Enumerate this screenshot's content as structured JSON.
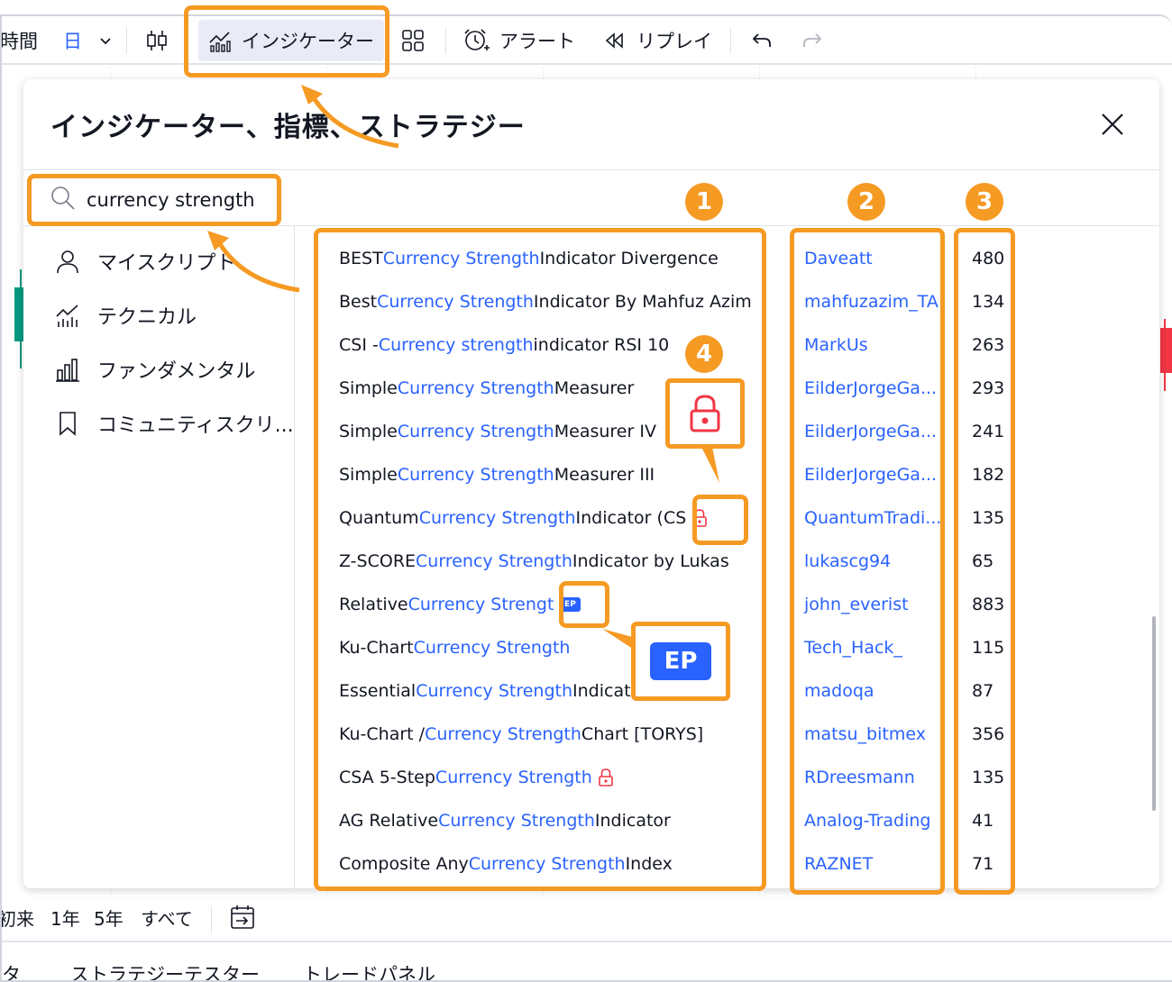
{
  "toolbar": {
    "timeframe_label": "時間",
    "interval": "日",
    "indicators_label": "インジケーター",
    "alert_label": "アラート",
    "replay_label": "リプレイ"
  },
  "dialog": {
    "title": "インジケーター、指標、ストラテジー",
    "search": {
      "value": "currency strength",
      "placeholder": ""
    },
    "sidebar": [
      {
        "label": "マイスクリプト",
        "icon": "user-icon"
      },
      {
        "label": "テクニカル",
        "icon": "technicals-icon"
      },
      {
        "label": "ファンダメンタル",
        "icon": "bar-chart-icon"
      },
      {
        "label": "コミュニティスクリ...",
        "icon": "bookmark-icon"
      }
    ],
    "results": [
      {
        "pre": "BEST ",
        "hl": "Currency Strength",
        "post": " Indicator Divergence",
        "author": "Daveatt",
        "count": "480"
      },
      {
        "pre": "Best ",
        "hl": "Currency Strength",
        "post": " Indicator By Mahfuz Azim",
        "author": "mahfuzazim_TA",
        "count": "134"
      },
      {
        "pre": "CSI - ",
        "hl": "Currency strength",
        "post": " indicator RSI 10",
        "author": "MarkUs",
        "count": "263"
      },
      {
        "pre": "Simple ",
        "hl": "Currency Strength",
        "post": " Measurer",
        "author": "EilderJorgeGa...",
        "count": "293"
      },
      {
        "pre": "Simple ",
        "hl": "Currency Strength",
        "post": " Measurer IV",
        "author": "EilderJorgeGa...",
        "count": "241"
      },
      {
        "pre": "Simple ",
        "hl": "Currency Strength",
        "post": " Measurer III",
        "author": "EilderJorgeGa...",
        "count": "182"
      },
      {
        "pre": "Quantum ",
        "hl": "Currency Strength",
        "post": " Indicator (CS",
        "author": "QuantumTradi...",
        "count": "135",
        "badge": "lock"
      },
      {
        "pre": "Z-SCORE ",
        "hl": "Currency Strength",
        "post": " Indicator by Lukas",
        "author": "lukascg94",
        "count": "65"
      },
      {
        "pre": "Relative ",
        "hl": "Currency Strengt",
        "post": "",
        "author": "john_everist",
        "count": "883",
        "badge": "ep"
      },
      {
        "pre": "Ku-Chart ",
        "hl": "Currency Strength",
        "post": "",
        "author": "Tech_Hack_",
        "count": "115"
      },
      {
        "pre": "Essential ",
        "hl": "Currency Strength",
        "post": " Indicat",
        "author": "madoqa",
        "count": "87"
      },
      {
        "pre": "Ku-Chart / ",
        "hl": "Currency Strength",
        "post": " Chart [TORYS]",
        "author": "matsu_bitmex",
        "count": "356"
      },
      {
        "pre": "CSA 5-Step ",
        "hl": "Currency Strength",
        "post": "",
        "author": "RDreesmann",
        "count": "135",
        "badge": "lock"
      },
      {
        "pre": "AG Relative ",
        "hl": "Currency Strength",
        "post": " Indicator",
        "author": "Analog-Trading",
        "count": "41"
      },
      {
        "pre": "Composite Any ",
        "hl": "Currency Strength",
        "post": " Index",
        "author": "RAZNET",
        "count": "71"
      }
    ]
  },
  "ep_label": "EP",
  "bottom": {
    "items": [
      "初来",
      "1年",
      "5年",
      "すべて"
    ]
  },
  "tabs": [
    "タ",
    "ストラテジーテスター",
    "トレードパネル"
  ],
  "annotations": {
    "n1": "1",
    "n2": "2",
    "n3": "3",
    "n4": "4"
  },
  "colors": {
    "accent": "#2962ff",
    "annotation": "#f59a23",
    "lock": "#f23645",
    "candle_up": "#089981",
    "candle_down": "#f23645"
  }
}
